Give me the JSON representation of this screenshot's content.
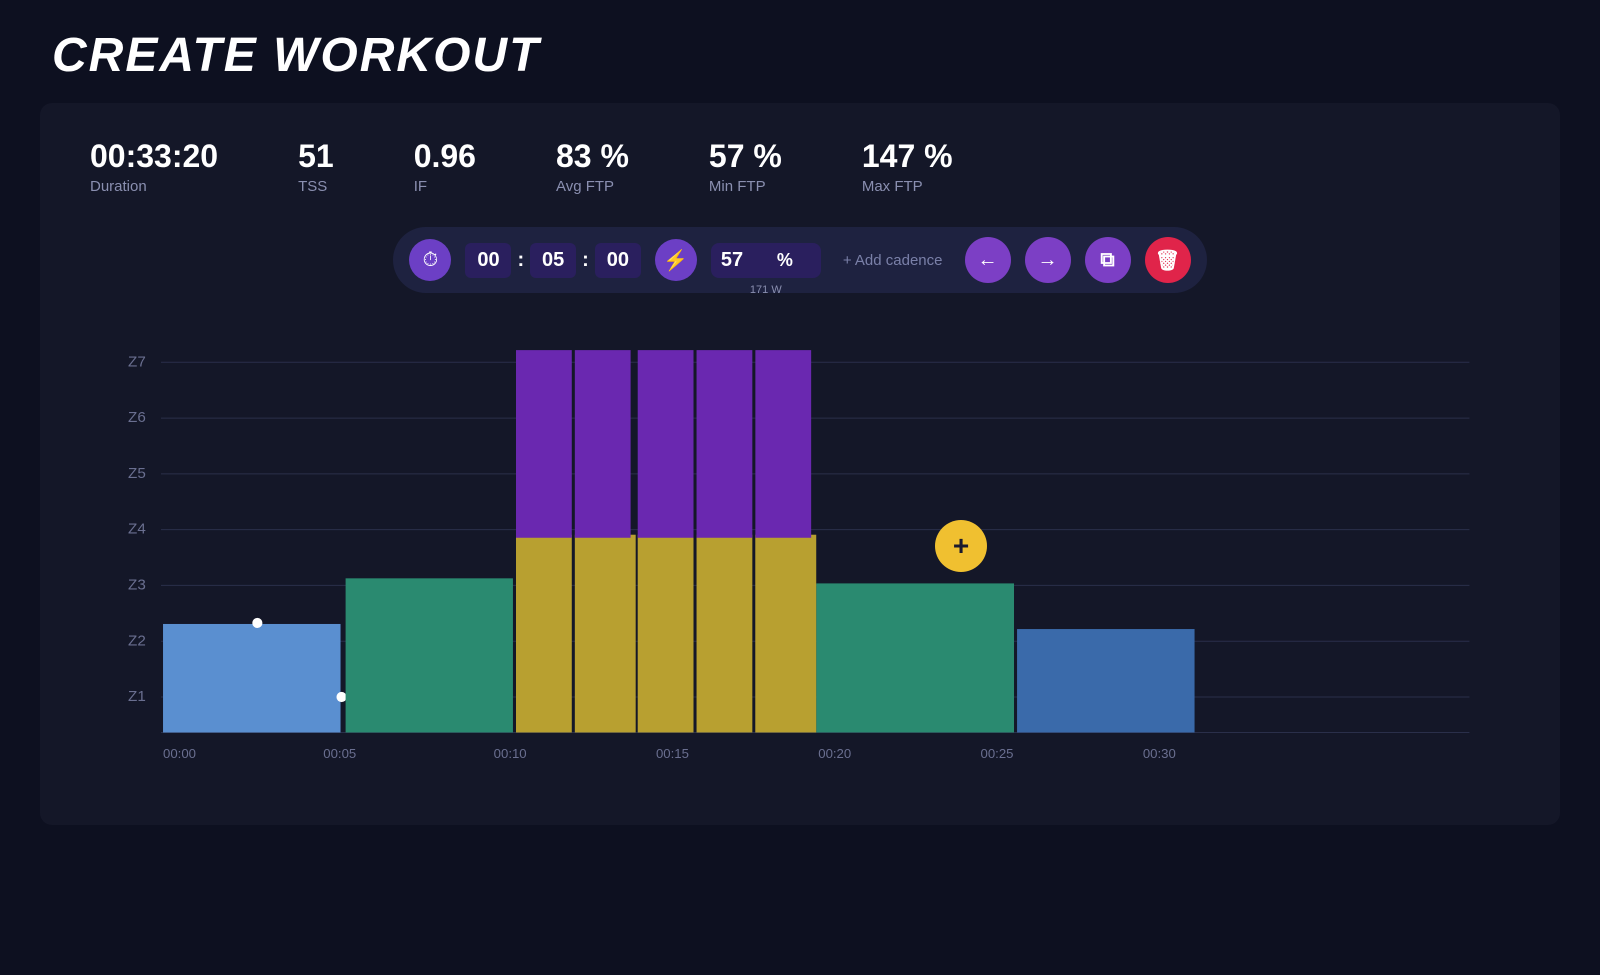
{
  "header": {
    "title": "CREATE WORKOUT"
  },
  "stats": [
    {
      "value": "00:33:20",
      "label": "Duration"
    },
    {
      "value": "51",
      "label": "TSS"
    },
    {
      "value": "0.96",
      "label": "IF"
    },
    {
      "value": "83 %",
      "label": "Avg FTP"
    },
    {
      "value": "57 %",
      "label": "Min FTP"
    },
    {
      "value": "147 %",
      "label": "Max FTP"
    }
  ],
  "controls": {
    "timer_icon": "⏱",
    "time_hh": "00",
    "time_mm": "05",
    "time_ss": "00",
    "bolt_icon": "⚡",
    "power_pct": "57",
    "power_pct_symbol": "%",
    "power_watts": "171 W",
    "add_cadence_label": "+ Add cadence",
    "back_arrow": "←",
    "forward_arrow": "→",
    "copy_icon": "⧉",
    "delete_icon": "🗑"
  },
  "chart": {
    "y_labels": [
      "Z7",
      "Z6",
      "Z5",
      "Z4",
      "Z3",
      "Z2",
      "Z1"
    ],
    "x_labels": [
      "00:00",
      "00:05",
      "00:10",
      "00:15",
      "00:20",
      "00:25",
      "00:30"
    ],
    "add_button": "+"
  }
}
